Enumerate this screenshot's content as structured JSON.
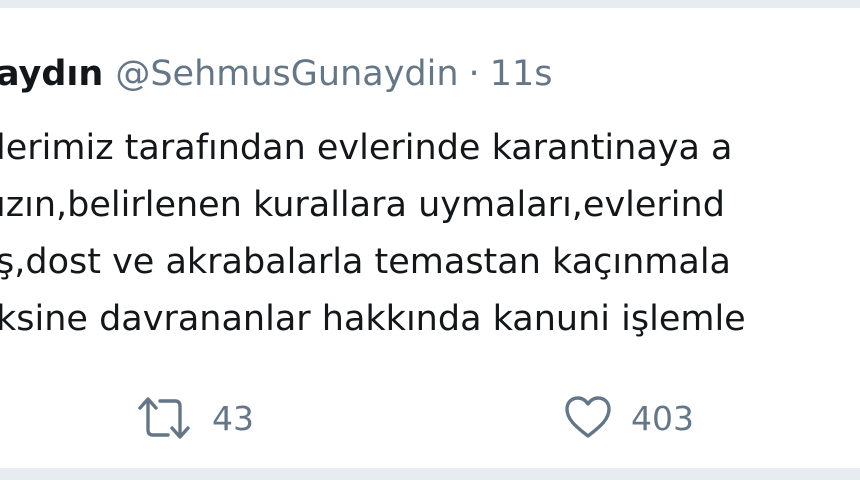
{
  "tweet": {
    "author_name": "aydın",
    "handle": "@SehmusGunaydin",
    "separator": "·",
    "timestamp": "11s",
    "lines": [
      "lerimiz tarafından evlerinde karantinaya a",
      "ızın,belirlenen kurallara uymaları,evlerind",
      "ş,dost ve akrabalarla temastan kaçınmala",
      "ksine davrananlar hakkında kanuni işlemle"
    ]
  },
  "actions": {
    "retweet_icon": "retweet-icon",
    "retweet_count": "43",
    "like_icon": "heart-icon",
    "like_count": "403"
  },
  "colors": {
    "text": "#14171a",
    "secondary": "#657786",
    "background": "#ffffff",
    "frame": "#e6ecf0"
  }
}
